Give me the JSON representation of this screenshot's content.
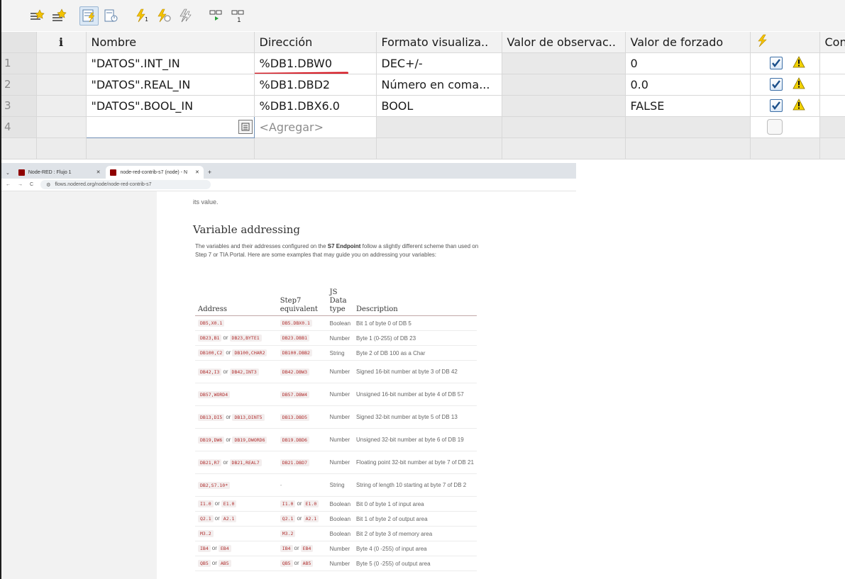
{
  "tia": {
    "toolbar": {
      "icons": [
        "add-variable-icon",
        "insert-row-icon",
        "monitor-active-icon",
        "monitor-once-icon",
        "force-icon",
        "stop-force-icon",
        "force-all-icon",
        "connect-icon",
        "connect-once-icon"
      ]
    },
    "columns": [
      "",
      "i",
      "Nombre",
      "Dirección",
      "Formato visualiza..",
      "Valor de observac..",
      "Valor de forzado",
      "",
      "Con"
    ],
    "rows": [
      {
        "num": "1",
        "name": "\"DATOS\".INT_IN",
        "address": "%DB1.DBW0",
        "format": "DEC+/-",
        "observe": "",
        "force": "0",
        "checked": true
      },
      {
        "num": "2",
        "name": "\"DATOS\".REAL_IN",
        "address": "%DB1.DBD2",
        "format": "Número en coma...",
        "observe": "",
        "force": "0.0",
        "checked": true
      },
      {
        "num": "3",
        "name": "\"DATOS\".BOOL_IN",
        "address": "%DB1.DBX6.0",
        "format": "BOOL",
        "observe": "",
        "force": "FALSE",
        "checked": true
      }
    ],
    "new_row": {
      "num": "4",
      "add_placeholder": "<Agregar>"
    },
    "colors": {
      "underline": "#d6202a",
      "warn": "#f2d200"
    }
  },
  "browser": {
    "tabs": [
      {
        "title": "Node-RED : Flujo 1"
      },
      {
        "title": "node-red-contrib-s7 (node) - N"
      }
    ],
    "url": "flows.nodered.org/node/node-red-contrib-s7",
    "doc": {
      "prev_text": "its value.",
      "heading": "Variable addressing",
      "intro_a": "The variables and their addresses configured on the ",
      "intro_b": "S7 Endpoint",
      "intro_c": " follow a slightly different scheme than used on Step 7 or TIA Portal. Here are some examples that may guide you on addressing your variables:",
      "headers": [
        "Address",
        "Step7 equivalent",
        "JS Data type",
        "Description"
      ],
      "rows": [
        {
          "addr": [
            "DB5,X0.1"
          ],
          "step7": [
            "DB5.DBX0.1"
          ],
          "type": "Boolean",
          "desc": "Bit 1 of byte 0 of DB 5"
        },
        {
          "addr": [
            "DB23,B1",
            "DB23,BYTE1"
          ],
          "step7": [
            "DB23.DBB1"
          ],
          "type": "Number",
          "desc": "Byte 1 (0-255) of DB 23"
        },
        {
          "addr": [
            "DB100,C2",
            "DB100,CHAR2"
          ],
          "step7": [
            "DB100.DBB2"
          ],
          "type": "String",
          "desc": "Byte 2 of DB 100 as a Char"
        },
        {
          "addr": [
            "DB42,I3",
            "DB42,INT3"
          ],
          "step7": [
            "DB42.DBW3"
          ],
          "type": "Number",
          "desc": "Signed 16-bit number at byte 3 of DB 42"
        },
        {
          "addr": [
            "DB57,WORD4"
          ],
          "step7": [
            "DB57.DBW4"
          ],
          "type": "Number",
          "desc": "Unsigned 16-bit number at byte 4 of DB 57"
        },
        {
          "addr": [
            "DB13,DI5",
            "DB13,DINT5"
          ],
          "step7": [
            "DB13.DBD5"
          ],
          "type": "Number",
          "desc": "Signed 32-bit number at byte 5 of DB 13"
        },
        {
          "addr": [
            "DB19,DW6",
            "DB19,DWORD6"
          ],
          "step7": [
            "DB19.DBD6"
          ],
          "type": "Number",
          "desc": "Unsigned 32-bit number at byte 6 of DB 19"
        },
        {
          "addr": [
            "DB21,R7",
            "DB21,REAL7"
          ],
          "step7": [
            "DB21.DBD7"
          ],
          "type": "Number",
          "desc": "Floating point 32-bit number at byte 7 of DB 21"
        },
        {
          "addr": [
            "DB2,S7.10*"
          ],
          "step7": [],
          "step7_text": "-",
          "type": "String",
          "desc": "String of length 10 starting at byte 7 of DB 2"
        },
        {
          "addr": [
            "I1.0",
            "E1.0"
          ],
          "step7": [
            "I1.0",
            "E1.0"
          ],
          "type": "Boolean",
          "desc": "Bit 0 of byte 1 of input area"
        },
        {
          "addr": [
            "Q2.1",
            "A2.1"
          ],
          "step7": [
            "Q2.1",
            "A2.1"
          ],
          "type": "Boolean",
          "desc": "Bit 1 of byte 2 of output area"
        },
        {
          "addr": [
            "M3.2"
          ],
          "step7": [
            "M3.2"
          ],
          "type": "Boolean",
          "desc": "Bit 2 of byte 3 of memory area"
        },
        {
          "addr": [
            "IB4",
            "EB4"
          ],
          "step7": [
            "IB4",
            "EB4"
          ],
          "type": "Number",
          "desc": "Byte 4 (0 -255) of input area"
        },
        {
          "addr": [
            "QB5",
            "AB5"
          ],
          "step7": [
            "QB5",
            "AB5"
          ],
          "type": "Number",
          "desc": "Byte 5 (0 -255) of output area"
        }
      ],
      "or_word": "or"
    }
  }
}
